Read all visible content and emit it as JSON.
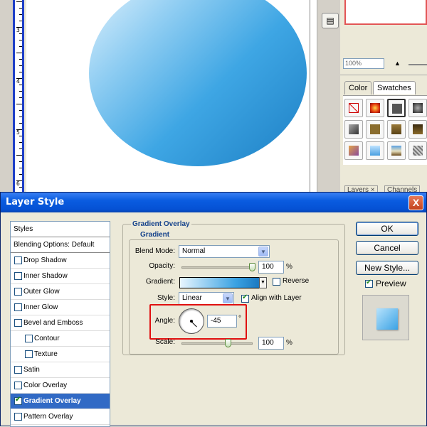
{
  "ruler": {
    "marks": [
      "3",
      "4",
      "5",
      "6"
    ]
  },
  "navigator": {
    "zoom": "100%"
  },
  "swatch_panel": {
    "tabs": [
      "Color",
      "Swatches"
    ],
    "bottom_tabs": [
      "Layers ×",
      "Channels"
    ]
  },
  "dialog": {
    "title": "Layer Style",
    "close": "X",
    "styles_list": [
      {
        "label": "Styles",
        "type": "head"
      },
      {
        "label": "Blending Options: Default",
        "type": "head"
      },
      {
        "label": "Drop Shadow",
        "checked": false
      },
      {
        "label": "Inner Shadow",
        "checked": false
      },
      {
        "label": "Outer Glow",
        "checked": false
      },
      {
        "label": "Inner Glow",
        "checked": false
      },
      {
        "label": "Bevel and Emboss",
        "checked": false
      },
      {
        "label": "Contour",
        "checked": false,
        "sub": true
      },
      {
        "label": "Texture",
        "checked": false,
        "sub": true
      },
      {
        "label": "Satin",
        "checked": false
      },
      {
        "label": "Color Overlay",
        "checked": false
      },
      {
        "label": "Gradient Overlay",
        "checked": true,
        "selected": true
      },
      {
        "label": "Pattern Overlay",
        "checked": false
      }
    ],
    "group_title": "Gradient Overlay",
    "subgroup_title": "Gradient",
    "blend_mode": {
      "label": "Blend Mode:",
      "value": "Normal"
    },
    "opacity": {
      "label": "Opacity:",
      "value": "100",
      "unit": "%",
      "level": 1.0
    },
    "gradient": {
      "label": "Gradient:",
      "reverse_label": "Reverse",
      "reverse_checked": false
    },
    "style": {
      "label": "Style:",
      "value": "Linear",
      "align_label": "Align with Layer",
      "align_checked": true
    },
    "angle": {
      "label": "Angle:",
      "value": "-45",
      "unit": "°",
      "degrees": -45
    },
    "scale": {
      "label": "Scale:",
      "value": "100",
      "unit": "%",
      "level": 0.66
    },
    "buttons": {
      "ok": "OK",
      "cancel": "Cancel",
      "new_style": "New Style..."
    },
    "preview": {
      "label": "Preview",
      "checked": true
    }
  }
}
